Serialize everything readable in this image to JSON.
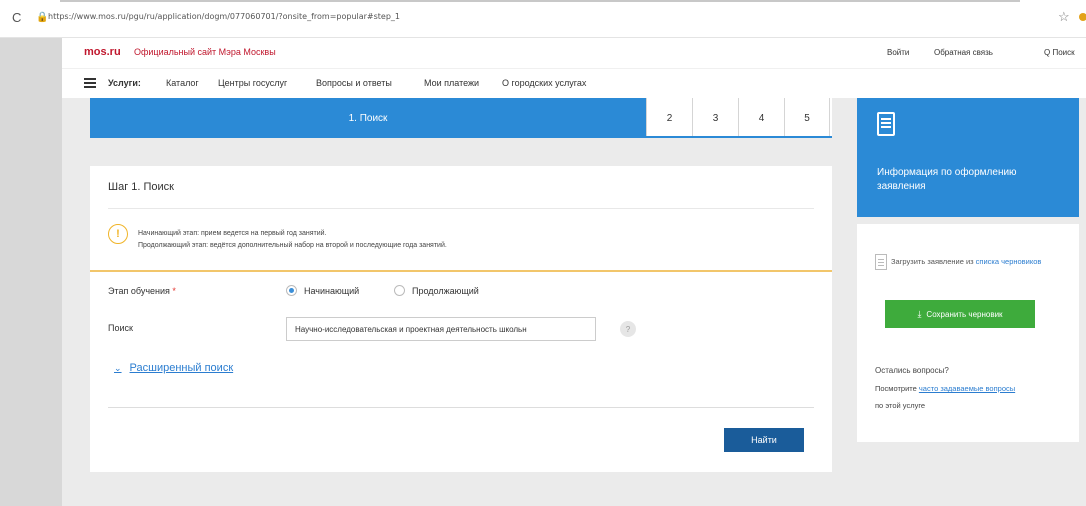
{
  "browser": {
    "url": "https://www.mos.ru/pgu/ru/application/dogm/077060701/?onsite_from=popular#step_1",
    "reload_glyph": "C",
    "lock_glyph": "🔒",
    "star_glyph": "☆"
  },
  "header": {
    "logo": "mos.ru",
    "tagline": "Официальный сайт Мэра Москвы",
    "login": "Войти",
    "feedback": "Обратная связь",
    "search": "Q Поиск"
  },
  "nav": {
    "items": [
      "Услуги:",
      "Каталог",
      "Центры госуслуг",
      "Вопросы и ответы",
      "Мои платежи",
      "О городских услугах"
    ]
  },
  "steps": {
    "active": "1. Поиск",
    "others": [
      "2",
      "3",
      "4",
      "5"
    ]
  },
  "form": {
    "step_title": "Шаг 1. Поиск",
    "warn_glyph": "!",
    "info_line1": "Начинающий этап: прием ведется на первый год занятий.",
    "info_line2": "Продолжающий этап: ведётся дополнительный набор на второй и последующие года занятий.",
    "stage_label": "Этап обучения",
    "required_mark": " *",
    "radio_options": [
      {
        "label": "Начинающий",
        "checked": true
      },
      {
        "label": "Продолжающий",
        "checked": false
      }
    ],
    "search_label": "Поиск",
    "search_value": "Научно-исследовательская и проектная деятельность школьн",
    "help_glyph": "?",
    "advanced_chevron": "⌄",
    "advanced_label": "Расширенный поиск",
    "find_button": "Найти"
  },
  "sidebar": {
    "info_title": "Информация по оформлению заявления",
    "draft_text_prefix": "Загрузить заявление из ",
    "draft_link": "списка черновиков",
    "save_icon": "⤓",
    "save_button": "Сохранить черновик",
    "questions_title": "Остались вопросы?",
    "faq_prefix": "Посмотрите ",
    "faq_link": "часто задаваемые вопросы",
    "faq_suffix": "по этой услуге"
  },
  "colors": {
    "brand_red": "#c0172d",
    "primary_blue": "#2b8ad6",
    "dark_blue": "#1a5c9a",
    "green": "#3eab3c",
    "warning": "#f0b428"
  }
}
